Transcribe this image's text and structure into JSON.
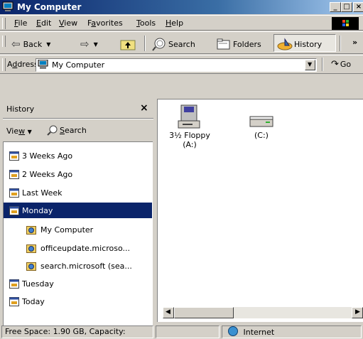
{
  "window": {
    "title": "My Computer"
  },
  "menu": {
    "items": [
      {
        "label": "File",
        "underline": "F"
      },
      {
        "label": "Edit",
        "underline": "E"
      },
      {
        "label": "View",
        "underline": "V"
      },
      {
        "label": "Favorites",
        "underline": "a"
      },
      {
        "label": "Tools",
        "underline": "T"
      },
      {
        "label": "Help",
        "underline": "H"
      }
    ]
  },
  "toolbar": {
    "back_label": "Back",
    "search_label": "Search",
    "folders_label": "Folders",
    "history_label": "History",
    "overflow": "»"
  },
  "address": {
    "label": "Address",
    "value": "My Computer",
    "go_label": "Go"
  },
  "history_pane": {
    "title": "History",
    "close": "×",
    "view_label": "View",
    "search_label": "Search",
    "items": [
      {
        "label": "3 Weeks Ago",
        "type": "calendar",
        "indent": 0,
        "selected": false
      },
      {
        "label": "2 Weeks Ago",
        "type": "calendar",
        "indent": 0,
        "selected": false
      },
      {
        "label": "Last Week",
        "type": "calendar",
        "indent": 0,
        "selected": false
      },
      {
        "label": "Monday",
        "type": "calendar",
        "indent": 0,
        "selected": true
      },
      {
        "label": "My Computer",
        "type": "globe-folder",
        "indent": 1,
        "selected": false
      },
      {
        "label": "officeupdate.microso...",
        "type": "globe-folder",
        "indent": 1,
        "selected": false
      },
      {
        "label": "search.microsoft (sea...",
        "type": "globe-folder",
        "indent": 1,
        "selected": false
      },
      {
        "label": "Tuesday",
        "type": "calendar",
        "indent": 0,
        "selected": false
      },
      {
        "label": "Today",
        "type": "calendar",
        "indent": 0,
        "selected": false
      }
    ]
  },
  "drives": [
    {
      "line1": "3½ Floppy",
      "line2": "(A:)",
      "icon": "floppy-drive-icon"
    },
    {
      "line1": "(C:)",
      "line2": "",
      "icon": "hard-drive-icon"
    }
  ],
  "status": {
    "left": "Free Space: 1.90 GB, Capacity:",
    "zone": "Internet"
  }
}
